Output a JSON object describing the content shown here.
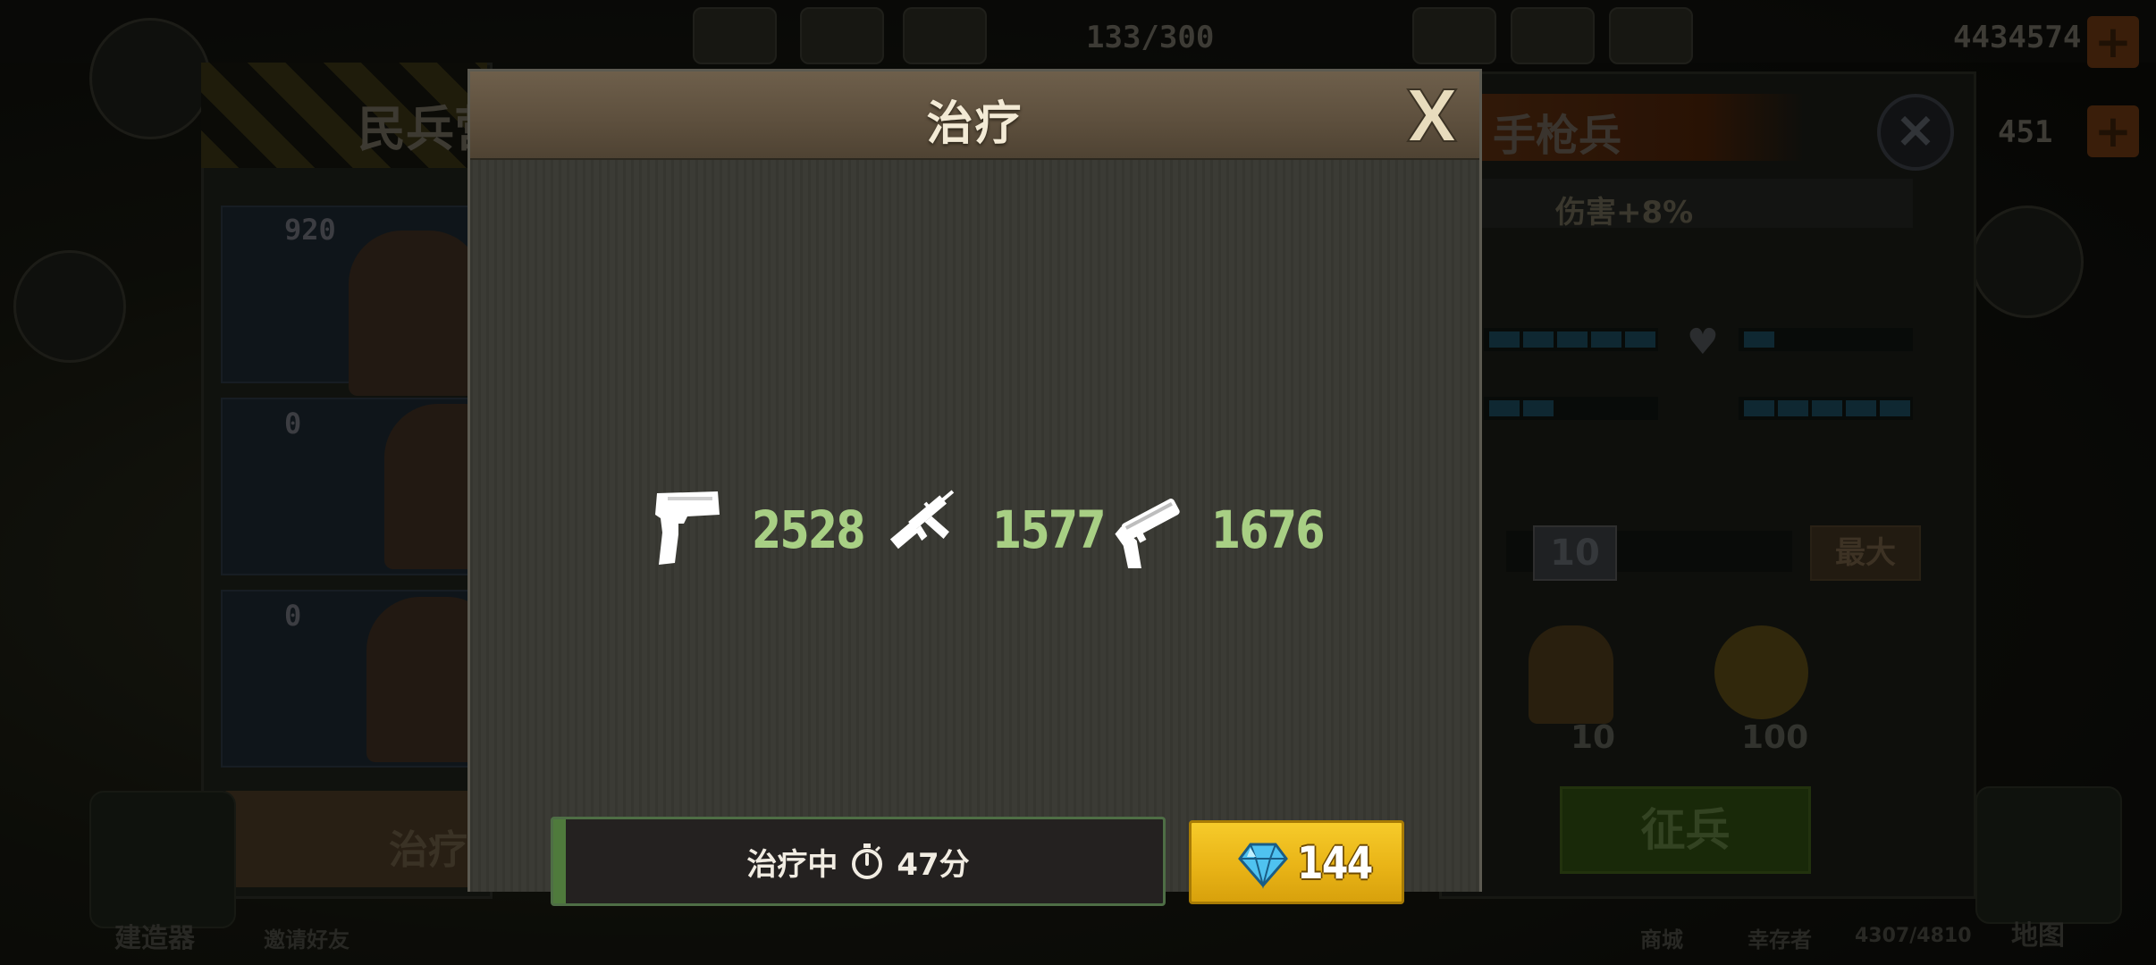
{
  "background": {
    "top_bar": {
      "resource_center": "133/300",
      "gold": "4434574",
      "secondary": "451"
    },
    "left_panel": {
      "title": "民兵营",
      "units": [
        {
          "icon": "pistol-icon",
          "count": "920"
        },
        {
          "icon": "rifle-icon",
          "count": "0"
        },
        {
          "icon": "shotgun-icon",
          "count": "0"
        }
      ],
      "button": "治疗"
    },
    "right_panel": {
      "title": "手枪兵",
      "bonus": "伤害+8%",
      "quantity": "10",
      "max_label": "最大",
      "survivor_cost": "10",
      "coin_cost": "100",
      "recruit_label": "征兵"
    },
    "bottom": {
      "builder": "建造器",
      "invite": "邀请好友",
      "map": "地图",
      "shop": "商城",
      "survivors": "幸存者",
      "pop": "4307/4810"
    }
  },
  "modal": {
    "title": "治疗",
    "weapons": [
      {
        "icon": "pistol-icon",
        "count": "2528"
      },
      {
        "icon": "assault-rifle-icon",
        "count": "1577"
      },
      {
        "icon": "shotgun-icon",
        "count": "1676"
      }
    ],
    "progress": {
      "status_label": "治疗中",
      "time_remaining": "47分",
      "fraction": 0.02
    },
    "speedup": {
      "icon": "gem-icon",
      "cost": "144"
    }
  },
  "colors": {
    "weapon_count": "#a8cf84",
    "button_gold": "#f2c21f",
    "progress_green": "#4f7a3c"
  }
}
